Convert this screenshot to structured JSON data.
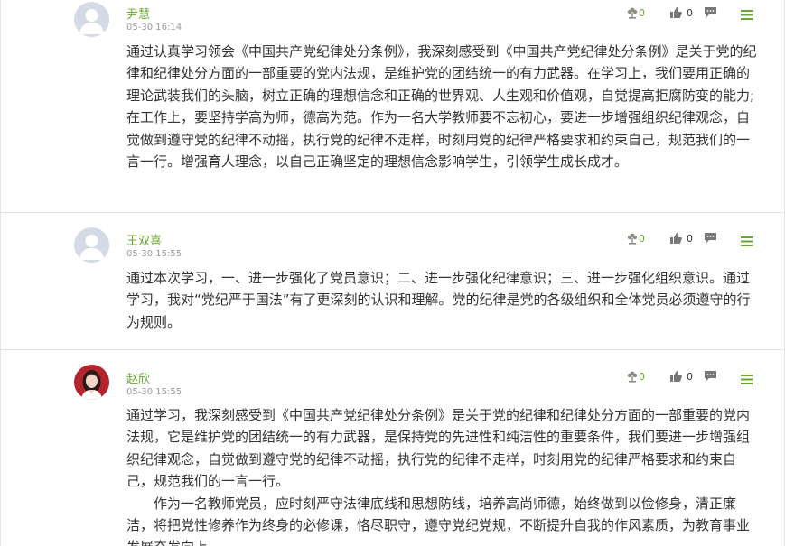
{
  "colors": {
    "name": "#6aa531",
    "share_icon": "#8a8f86",
    "menu_icon": "#6aa531"
  },
  "comments": [
    {
      "name": "尹慧",
      "time": "05-30 16:14",
      "avatar": "default-avatar",
      "share_count": "0",
      "like_count": "0",
      "paragraphs": [
        "通过认真学习领会《中国共产党纪律处分条例》，我深刻感受到《中国共产党纪律处分条例》是关于党的纪律和纪律处分方面的一部重要的党内法规，是维护党的团结统一的有力武器。在学习上，我们要用正确的理论武装我们的头脑，树立正确的理想信念和正确的世界观、人生观和价值观，自觉提高拒腐防变的能力;在工作上，要坚持学高为师，德高为范。作为一名大学教师要不忘初心，要进一步增强组织纪律观念，自觉做到遵守党的纪律不动摇，执行党的纪律不走样，时刻用党的纪律严格要求和约束自己，规范我们的一言一行。增强育人理念，以自己正确坚定的理想信念影响学生，引领学生成长成才。"
      ]
    },
    {
      "name": "王双喜",
      "time": "05-30 15:55",
      "avatar": "default-avatar",
      "share_count": "0",
      "like_count": "0",
      "paragraphs": [
        "通过本次学习，一、进一步强化了党员意识；二、进一步强化纪律意识；三、进一步强化组织意识。通过学习，我对“党纪严于国法”有了更深刻的认识和理解。党的纪律是党的各级组织和全体党员必须遵守的行为规则。"
      ]
    },
    {
      "name": "赵欣",
      "time": "05-30 15:55",
      "avatar": "photo-avatar",
      "share_count": "0",
      "like_count": "0",
      "paragraphs": [
        "通过学习，我深刻感受到《中国共产党纪律处分条例》是关于党的纪律和纪律处分方面的一部重要的党内法规，它是维护党的团结统一的有力武器，是保持党的先进性和纯洁性的重要条件，我们要进一步增强组织纪律观念，自觉做到遵守党的纪律不动摇，执行党的纪律不走样，时刻用党的纪律严格要求和约束自己，规范我们的一言一行。",
        "作为一名教师党员，应时刻严守法律底线和思想防线，培养高尚师德，始终做到以俭修身，清正廉洁，将把党性修养作为终身的必修课，恪尽职守，遵守党纪党规，不断提升自我的作风素质，为教育事业发展奋发向上。"
      ]
    }
  ]
}
